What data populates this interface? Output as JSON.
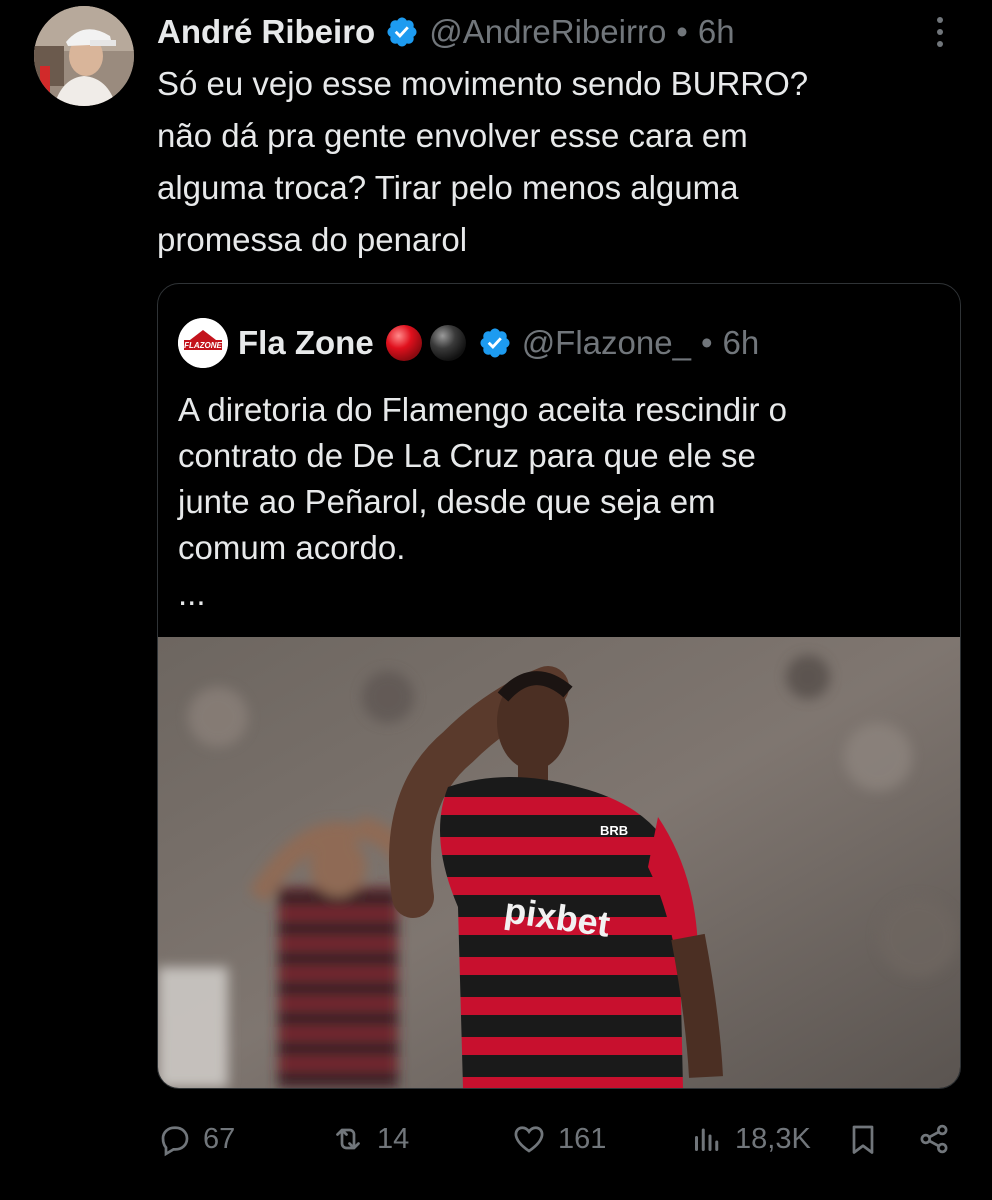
{
  "author": {
    "name": "André Ribeiro",
    "handle": "@AndreRibeirro",
    "separator": "•",
    "time": "6h"
  },
  "tweet_lines": [
    "Só eu vejo esse movimento sendo BURRO?",
    "não dá pra gente envolver esse cara em",
    "alguma troca? Tirar pelo menos alguma",
    "promessa do penarol"
  ],
  "quote": {
    "avatar_text": "FLAZONE",
    "name": "Fla Zone",
    "handle": "@Flazone_",
    "separator": "•",
    "time": "6h",
    "lines": [
      "A diretoria do Flamengo aceita rescindir o",
      "contrato de De La Cruz para que ele se",
      "junte ao Peñarol, desde que seja em",
      "comum acordo.",
      "..."
    ],
    "photo": {
      "jersey_sponsor": "pixbet",
      "jersey_badge": "BRB"
    }
  },
  "actions": {
    "replies": "67",
    "reposts": "14",
    "likes": "161",
    "views": "18,3K"
  },
  "colors": {
    "background": "#000000",
    "text": "#e7e9ea",
    "muted": "#71767b",
    "verified": "#1d9bf0",
    "border": "#2f3336"
  }
}
